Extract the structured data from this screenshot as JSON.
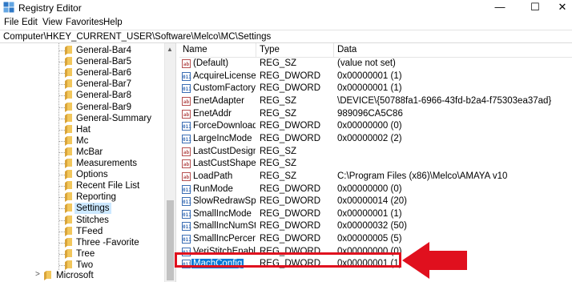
{
  "window": {
    "title": "Registry Editor",
    "minimize_glyph": "—",
    "maximize_glyph": "☐",
    "close_glyph": "✕",
    "app_icon": "registry-icon"
  },
  "menu": [
    "File",
    "Edit",
    "View",
    "Favorites",
    "Help"
  ],
  "address": "Computer\\HKEY_CURRENT_USER\\Software\\Melco\\MC\\Settings",
  "tree": {
    "items": [
      {
        "label": "General-Bar4"
      },
      {
        "label": "General-Bar5"
      },
      {
        "label": "General-Bar6"
      },
      {
        "label": "General-Bar7"
      },
      {
        "label": "General-Bar8"
      },
      {
        "label": "General-Bar9"
      },
      {
        "label": "General-Summary"
      },
      {
        "label": "Hat"
      },
      {
        "label": "Mc"
      },
      {
        "label": "McBar"
      },
      {
        "label": "Measurements"
      },
      {
        "label": "Options"
      },
      {
        "label": "Recent File List"
      },
      {
        "label": "Reporting"
      },
      {
        "label": "Settings",
        "selected": true
      },
      {
        "label": "Stitches"
      },
      {
        "label": "TFeed"
      },
      {
        "label": "Three -Favorite"
      },
      {
        "label": "Tree"
      },
      {
        "label": "Two"
      }
    ],
    "parent": {
      "label": "Microsoft",
      "expander": ">"
    }
  },
  "columns": {
    "name": "Name",
    "type": "Type",
    "data": "Data"
  },
  "values": [
    {
      "icon": "ab",
      "name": "(Default)",
      "type": "REG_SZ",
      "data": "(value not set)"
    },
    {
      "icon": "011",
      "name": "AcquireLicense",
      "type": "REG_DWORD",
      "data": "0x00000001 (1)"
    },
    {
      "icon": "011",
      "name": "CustomFactoryI...",
      "type": "REG_DWORD",
      "data": "0x00000001 (1)"
    },
    {
      "icon": "ab",
      "name": "EnetAdapter",
      "type": "REG_SZ",
      "data": "\\DEVICE\\{50788fa1-6966-43fd-b2a4-f75303ea37ad}"
    },
    {
      "icon": "ab",
      "name": "EnetAddr",
      "type": "REG_SZ",
      "data": "989096CA5C86"
    },
    {
      "icon": "011",
      "name": "ForceDownload",
      "type": "REG_DWORD",
      "data": "0x00000000 (0)"
    },
    {
      "icon": "011",
      "name": "LargeIncMode",
      "type": "REG_DWORD",
      "data": "0x00000002 (2)"
    },
    {
      "icon": "ab",
      "name": "LastCustDesignCat",
      "type": "REG_SZ",
      "data": ""
    },
    {
      "icon": "ab",
      "name": "LastCustShapeCat",
      "type": "REG_SZ",
      "data": ""
    },
    {
      "icon": "ab",
      "name": "LoadPath",
      "type": "REG_SZ",
      "data": "C:\\Program Files (x86)\\Melco\\AMAYA v10"
    },
    {
      "icon": "011",
      "name": "RunMode",
      "type": "REG_DWORD",
      "data": "0x00000000 (0)"
    },
    {
      "icon": "011",
      "name": "SlowRedrawSpe...",
      "type": "REG_DWORD",
      "data": "0x00000014 (20)"
    },
    {
      "icon": "011",
      "name": "SmallIncMode",
      "type": "REG_DWORD",
      "data": "0x00000001 (1)"
    },
    {
      "icon": "011",
      "name": "SmallIncNumStit...",
      "type": "REG_DWORD",
      "data": "0x00000032 (50)"
    },
    {
      "icon": "011",
      "name": "SmallIncPercent",
      "type": "REG_DWORD",
      "data": "0x00000005 (5)"
    },
    {
      "icon": "011",
      "name": "VeriStitchEnable",
      "type": "REG_DWORD",
      "data": "0x00000000 (0)"
    },
    {
      "icon": "011",
      "name": "MachConfig",
      "type": "REG_DWORD",
      "data": "0x00000001 (1)",
      "selected": true
    }
  ],
  "colors": {
    "highlight": "#e0101e",
    "selection": "#0078d7",
    "folder": "#e8b84a"
  }
}
